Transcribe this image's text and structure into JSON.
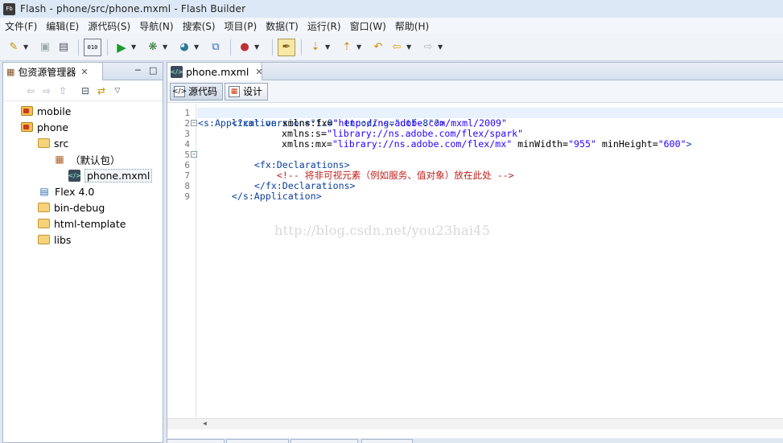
{
  "window": {
    "app_icon_text": "Fb",
    "title": "Flash  -  phone/src/phone.mxml  -  Flash Builder"
  },
  "menu": [
    "文件(F)",
    "编辑(E)",
    "源代码(S)",
    "导航(N)",
    "搜索(S)",
    "项目(P)",
    "数据(T)",
    "运行(R)",
    "窗口(W)",
    "帮助(H)"
  ],
  "toolbar": {
    "icons": [
      "new-icon",
      "save-icon",
      "print-icon",
      "binary-icon",
      "run-icon",
      "debug-icon",
      "profile-icon",
      "export-icon",
      "external-tools-icon",
      "toggle-mark-icon",
      "next-annotation-icon",
      "prev-annotation-icon",
      "last-edit-icon",
      "back-icon",
      "forward-icon"
    ],
    "binary_label": "010"
  },
  "package_explorer": {
    "tab_label": "包资源管理器",
    "tree": [
      {
        "label": "mobile",
        "type": "project",
        "depth": 0
      },
      {
        "label": "phone",
        "type": "project",
        "depth": 0
      },
      {
        "label": "src",
        "type": "src-folder",
        "depth": 1
      },
      {
        "label": "（默认包）",
        "type": "package",
        "depth": 2
      },
      {
        "label": "phone.mxml",
        "type": "mxml-file",
        "depth": 3,
        "selected": true
      },
      {
        "label": "Flex 4.0",
        "type": "library",
        "depth": 1
      },
      {
        "label": "bin-debug",
        "type": "folder",
        "depth": 1
      },
      {
        "label": "html-template",
        "type": "folder",
        "depth": 1
      },
      {
        "label": "libs",
        "type": "folder",
        "depth": 1
      }
    ]
  },
  "editor": {
    "tab_label": "phone.mxml",
    "mode_source_label": "源代码",
    "mode_design_label": "设计",
    "line_numbers": [
      "1",
      "2",
      "3",
      "4",
      "5",
      "6",
      "7",
      "8",
      "9"
    ],
    "code": {
      "l1": "<?xml version=\"1.0\" encoding=\"utf-8\"?>",
      "l2_tag": "<s:Application",
      "l2_attr": " xmlns:fx=",
      "l2_val": "\"http://ns.adobe.com/mxml/2009\"",
      "l3_attr": "xmlns:s=",
      "l3_val": "\"library://ns.adobe.com/flex/spark\"",
      "l4_attr": "xmlns:mx=",
      "l4_val": "\"library://ns.adobe.com/flex/mx\"",
      "l4_attr2": " minWidth=",
      "l4_val2": "\"955\"",
      "l4_attr3": " minHeight=",
      "l4_val3": "\"600\"",
      "l4_close": ">",
      "l5": "<fx:Declarations>",
      "l6": "<!-- 将非可视元素（例如服务、值对象）放在此处 -->",
      "l7": "</fx:Declarations>",
      "l8": "</s:Application>"
    },
    "watermark": "http://blog.csdn.net/you23hai45"
  }
}
